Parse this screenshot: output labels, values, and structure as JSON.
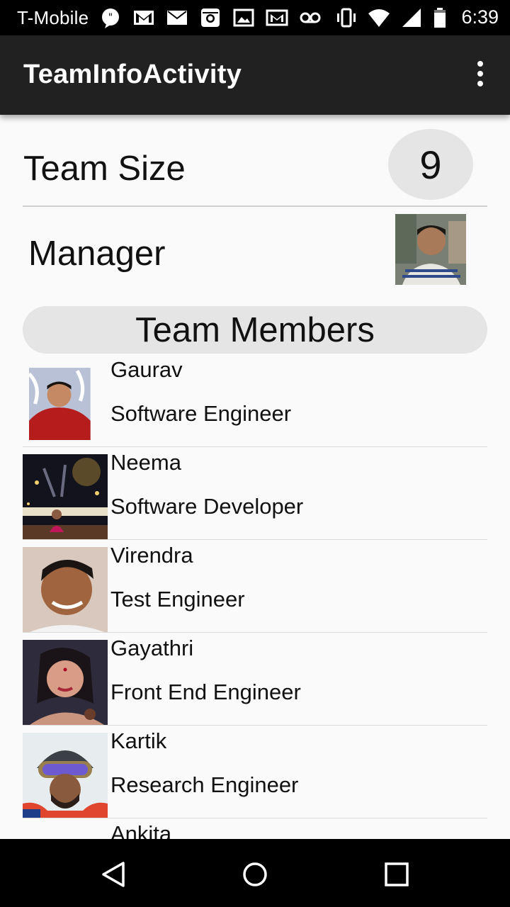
{
  "status_bar": {
    "carrier": "T-Mobile",
    "time": "6:39",
    "icons": [
      "chat-bubble-icon",
      "gmail-icon",
      "email-icon",
      "instagram-icon",
      "image-icon",
      "gmail-icon",
      "voicemail-icon",
      "vibrate-icon",
      "wifi-icon",
      "signal-icon",
      "battery-icon"
    ]
  },
  "app_bar": {
    "title": "TeamInfoActivity",
    "overflow_icon": "more-vert-icon"
  },
  "team_size": {
    "label": "Team Size",
    "value": "9"
  },
  "manager": {
    "label": "Manager"
  },
  "members_header": "Team Members",
  "members": [
    {
      "name": "Gaurav",
      "role": "Software Engineer"
    },
    {
      "name": "Neema",
      "role": "Software Developer"
    },
    {
      "name": "Virendra",
      "role": "Test Engineer"
    },
    {
      "name": "Gayathri",
      "role": "Front End Engineer"
    },
    {
      "name": "Kartik",
      "role": "Research Engineer"
    },
    {
      "name": "Ankita",
      "role": ""
    }
  ],
  "nav_bar": {
    "icons": [
      "back-icon",
      "home-icon",
      "recents-icon"
    ]
  },
  "colors": {
    "app_bar": "#212121",
    "badge_bg": "#e5e5e5",
    "status_bar": "#000000"
  }
}
